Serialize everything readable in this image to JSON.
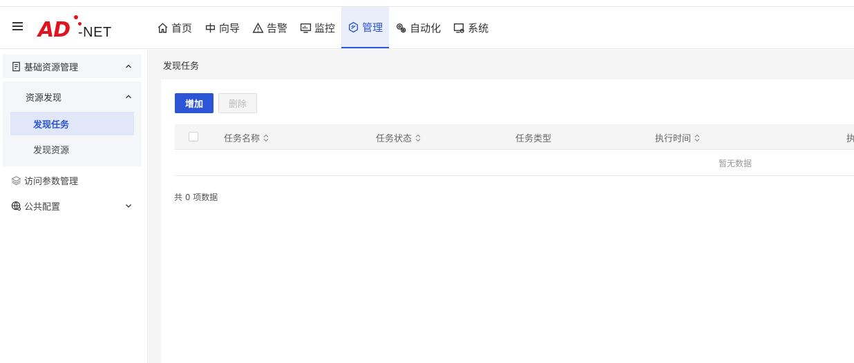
{
  "brand": {
    "logo_main": "AD",
    "logo_suffix": "-NET",
    "brand_color": "#e0141e"
  },
  "nav": [
    {
      "label": "首页",
      "icon": "home-icon"
    },
    {
      "label": "向导",
      "icon": "guide-icon"
    },
    {
      "label": "告警",
      "icon": "alert-icon"
    },
    {
      "label": "监控",
      "icon": "monitor-icon"
    },
    {
      "label": "管理",
      "icon": "manage-icon",
      "active": true
    },
    {
      "label": "自动化",
      "icon": "automation-icon"
    },
    {
      "label": "系统",
      "icon": "system-icon"
    }
  ],
  "sidebar": {
    "group": {
      "label": "基础资源管理",
      "icon": "resource-doc-icon"
    },
    "sub_group": {
      "label": "资源发现"
    },
    "sub_items": [
      {
        "label": "发现任务",
        "active": true
      },
      {
        "label": "发现资源"
      }
    ],
    "items": [
      {
        "label": "访问参数管理",
        "icon": "layers-icon"
      },
      {
        "label": "公共配置",
        "icon": "globe-gear-icon"
      }
    ]
  },
  "breadcrumb": "发现任务",
  "toolbar": {
    "add_label": "增加",
    "delete_label": "删除"
  },
  "table": {
    "columns": [
      {
        "label": "任务名称",
        "sortable": true
      },
      {
        "label": "任务状态",
        "sortable": true
      },
      {
        "label": "任务类型",
        "sortable": false
      },
      {
        "label": "执行时间",
        "sortable": true
      },
      {
        "label": "执",
        "sortable": false
      }
    ],
    "empty_text": "暂无数据"
  },
  "total_text": "共 0 项数据",
  "colors": {
    "accent": "#2b55d6",
    "active_bg": "#e9eefa"
  }
}
